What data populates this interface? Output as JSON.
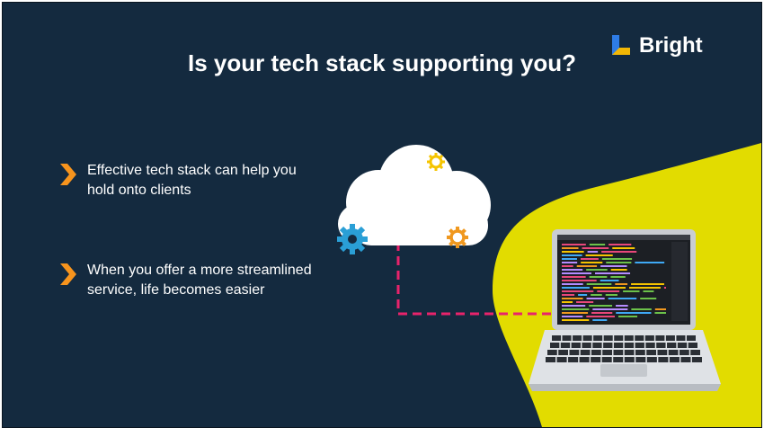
{
  "title": "Is your tech stack supporting you?",
  "logo": {
    "text": "Bright",
    "mark_colors": [
      "#2e7ce6",
      "#f2b705"
    ]
  },
  "bullets": [
    {
      "text": "Effective tech stack can help you hold onto clients",
      "icon": "chevron-right-icon"
    },
    {
      "text": "When you offer a more streamlined service, life becomes easier",
      "icon": "chevron-right-icon"
    }
  ],
  "colors": {
    "background": "#142a3f",
    "accent_yellow": "#e2dc00",
    "bullet_orange": "#f7941d",
    "connector_pink": "#e8236b",
    "cloud": "#ffffff",
    "gear_blue": "#2a9fd6",
    "gear_yellow": "#f5c400",
    "gear_orange": "#f0981f"
  },
  "illustration": {
    "items": [
      "cloud-icon",
      "gear-icon",
      "laptop-icon",
      "code-editor-screen"
    ]
  }
}
